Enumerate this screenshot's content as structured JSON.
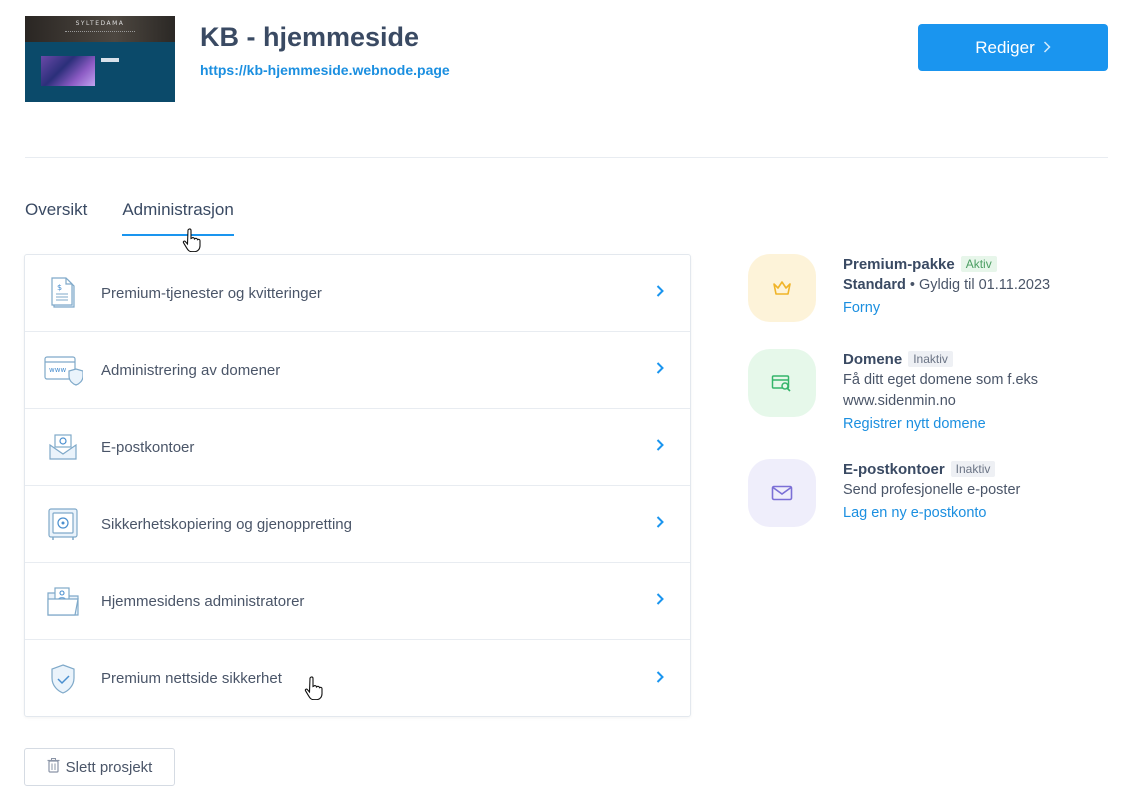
{
  "header": {
    "thumbnail_brand": "SYLTEDAMA",
    "title": "KB - hjemmeside",
    "url": "https://kb-hjemmeside.webnode.page",
    "edit_label": "Rediger",
    "edit_icon": "chevron-right-icon"
  },
  "tabs": [
    {
      "label": "Oversikt",
      "active": false
    },
    {
      "label": "Administrasjon",
      "active": true
    }
  ],
  "menu": {
    "items": [
      {
        "label": "Premium-tjenester og kvitteringer",
        "icon": "receipt-icon"
      },
      {
        "label": "Administrering av domener",
        "icon": "domain-shield-icon"
      },
      {
        "label": "E-postkontoer",
        "icon": "email-envelope-icon"
      },
      {
        "label": "Sikkerhetskopiering og gjenoppretting",
        "icon": "backup-safe-icon"
      },
      {
        "label": "Hjemmesidens administratorer",
        "icon": "admin-folder-icon"
      },
      {
        "label": "Premium nettside sikkerhet",
        "icon": "shield-check-icon"
      }
    ]
  },
  "services": [
    {
      "name": "Premium-pakke",
      "badge": "Aktiv",
      "plan": "Standard",
      "detail": " • Gyldig til 01.11.2023",
      "link": "Forny",
      "icon": "crown-icon",
      "color": "#fdf3d9",
      "icon_color": "#f0b429"
    },
    {
      "name": "Domene",
      "badge": "Inaktiv",
      "detail": "Få ditt eget domene som f.eks www.sidenmin.no",
      "link": "Registrer nytt domene",
      "icon": "domain-search-icon",
      "color": "#e6f8ea",
      "icon_color": "#34b56a"
    },
    {
      "name": "E-postkontoer",
      "badge": "Inaktiv",
      "detail": "Send profesjonelle e-poster",
      "link": "Lag en ny e-postkonto",
      "icon": "envelope-icon",
      "color": "#efeefb",
      "icon_color": "#7b6fd6"
    }
  ],
  "footer": {
    "delete_label": "Slett prosjekt",
    "delete_icon": "trash-icon"
  },
  "colors": {
    "accent": "#1a95ef",
    "link": "#1b8fe0",
    "text": "#3a4a63"
  }
}
